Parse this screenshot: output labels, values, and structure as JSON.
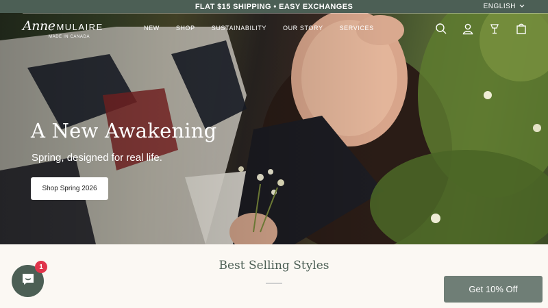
{
  "announcement": {
    "text": "FLAT $15 SHIPPING • EASY EXCHANGES"
  },
  "header": {
    "language": "ENGLISH",
    "logo": {
      "script": "Anne",
      "name": "MULAIRE",
      "sub": "MADE IN CANADA"
    },
    "nav": [
      "NEW",
      "SHOP",
      "SUSTAINABILITY",
      "OUR STORY",
      "SERVICES"
    ],
    "icons": [
      "search-icon",
      "account-icon",
      "wishlist-icon",
      "cart-icon"
    ]
  },
  "hero": {
    "title": "A New Awakening",
    "subtitle": "Spring, designed for real life.",
    "cta": "Shop Spring 2026"
  },
  "section": {
    "title": "Best Selling Styles"
  },
  "chat": {
    "badge": "1"
  },
  "promo": {
    "label": "Get 10% Off"
  },
  "colors": {
    "brand": "#4c5f55",
    "promo": "#6f7e76",
    "badge": "#e0354b",
    "background": "#fbf8f3"
  }
}
